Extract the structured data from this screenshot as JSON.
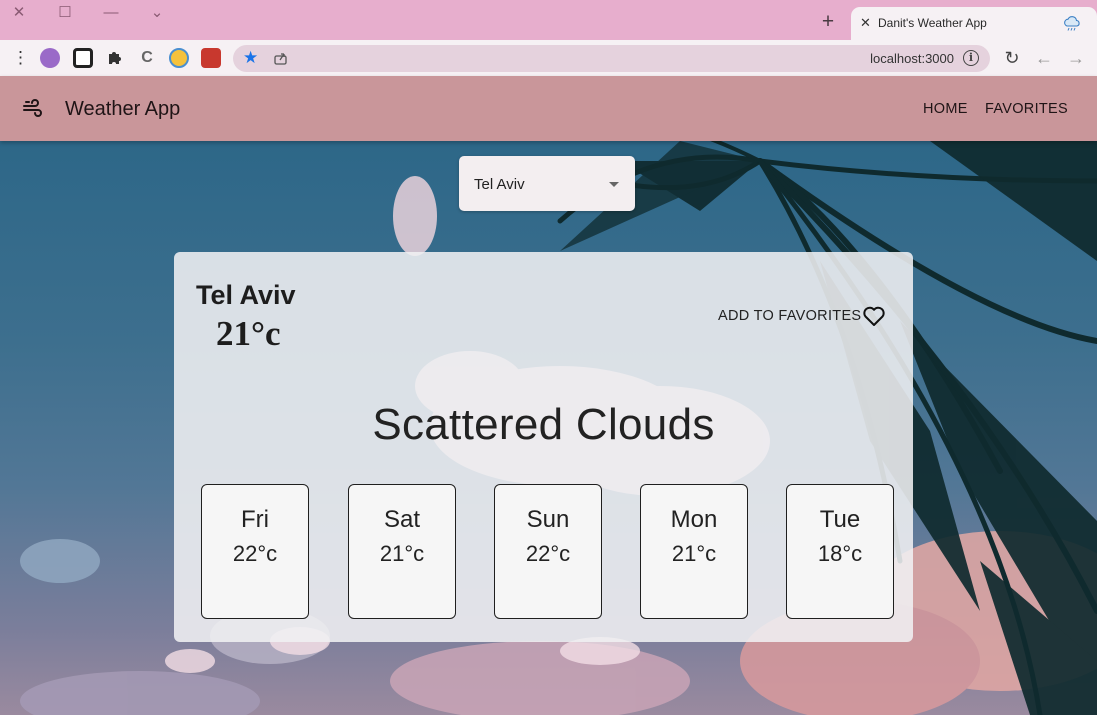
{
  "browser": {
    "tab_title": "Danit's Weather App",
    "tab_close_icon": "close-icon",
    "new_tab_label": "+",
    "url": "localhost:3000",
    "window_controls": [
      "close-icon",
      "maximize-icon",
      "minimize-icon",
      "chevron-down-icon"
    ],
    "extensions": [
      "puzzle-piece-icon"
    ]
  },
  "app": {
    "menu_icon": "wind-icon",
    "title": "Weather App",
    "nav": {
      "home": "HOME",
      "favorites": "FAVORITES"
    }
  },
  "search": {
    "selected_city": "Tel Aviv"
  },
  "weather": {
    "city": "Tel Aviv",
    "temperature": "21°c",
    "add_to_favorites": "ADD TO FAVORITES",
    "condition": "Scattered Clouds",
    "forecast": [
      {
        "day": "Fri",
        "temp": "22°c"
      },
      {
        "day": "Sat",
        "temp": "21°c"
      },
      {
        "day": "Sun",
        "temp": "22°c"
      },
      {
        "day": "Mon",
        "temp": "21°c"
      },
      {
        "day": "Tue",
        "temp": "18°c"
      }
    ]
  },
  "colors": {
    "tab_bar": "#e7aecd",
    "app_bar": "#c9969a",
    "card_background": "#f0f0f2",
    "accent_star": "#1a73e8"
  }
}
